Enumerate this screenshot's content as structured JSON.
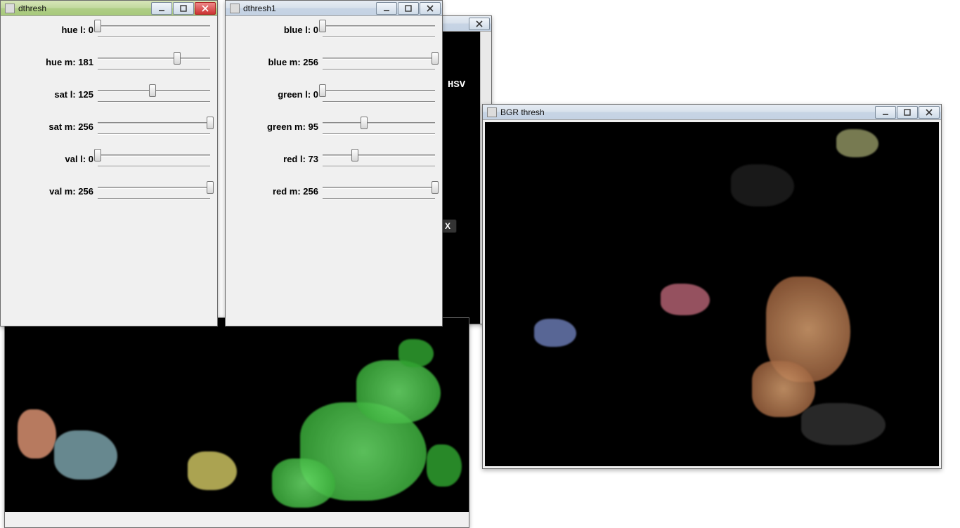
{
  "windows": {
    "dthresh": {
      "title": "dthresh",
      "sliders": [
        {
          "key": "hue_l",
          "label": "hue l",
          "value": 0,
          "max": 256
        },
        {
          "key": "hue_m",
          "label": "hue m",
          "value": 181,
          "max": 256
        },
        {
          "key": "sat_l",
          "label": "sat l",
          "value": 125,
          "max": 256
        },
        {
          "key": "sat_m",
          "label": "sat m",
          "value": 256,
          "max": 256
        },
        {
          "key": "val_l",
          "label": "val l",
          "value": 0,
          "max": 256
        },
        {
          "key": "val_m",
          "label": "val m",
          "value": 256,
          "max": 256
        }
      ]
    },
    "dthresh1": {
      "title": "dthresh1",
      "sliders": [
        {
          "key": "blue_l",
          "label": "blue l",
          "value": 0,
          "max": 256
        },
        {
          "key": "blue_m",
          "label": "blue m",
          "value": 256,
          "max": 256
        },
        {
          "key": "green_l",
          "label": "green l",
          "value": 0,
          "max": 256
        },
        {
          "key": "green_m",
          "label": "green m",
          "value": 95,
          "max": 256
        },
        {
          "key": "red_l",
          "label": "red l",
          "value": 73,
          "max": 256
        },
        {
          "key": "red_m",
          "label": "red m",
          "value": 256,
          "max": 256
        }
      ]
    },
    "bgr": {
      "title": "BGR thresh"
    },
    "hsv_bg": {
      "label_text": "HSV"
    }
  }
}
